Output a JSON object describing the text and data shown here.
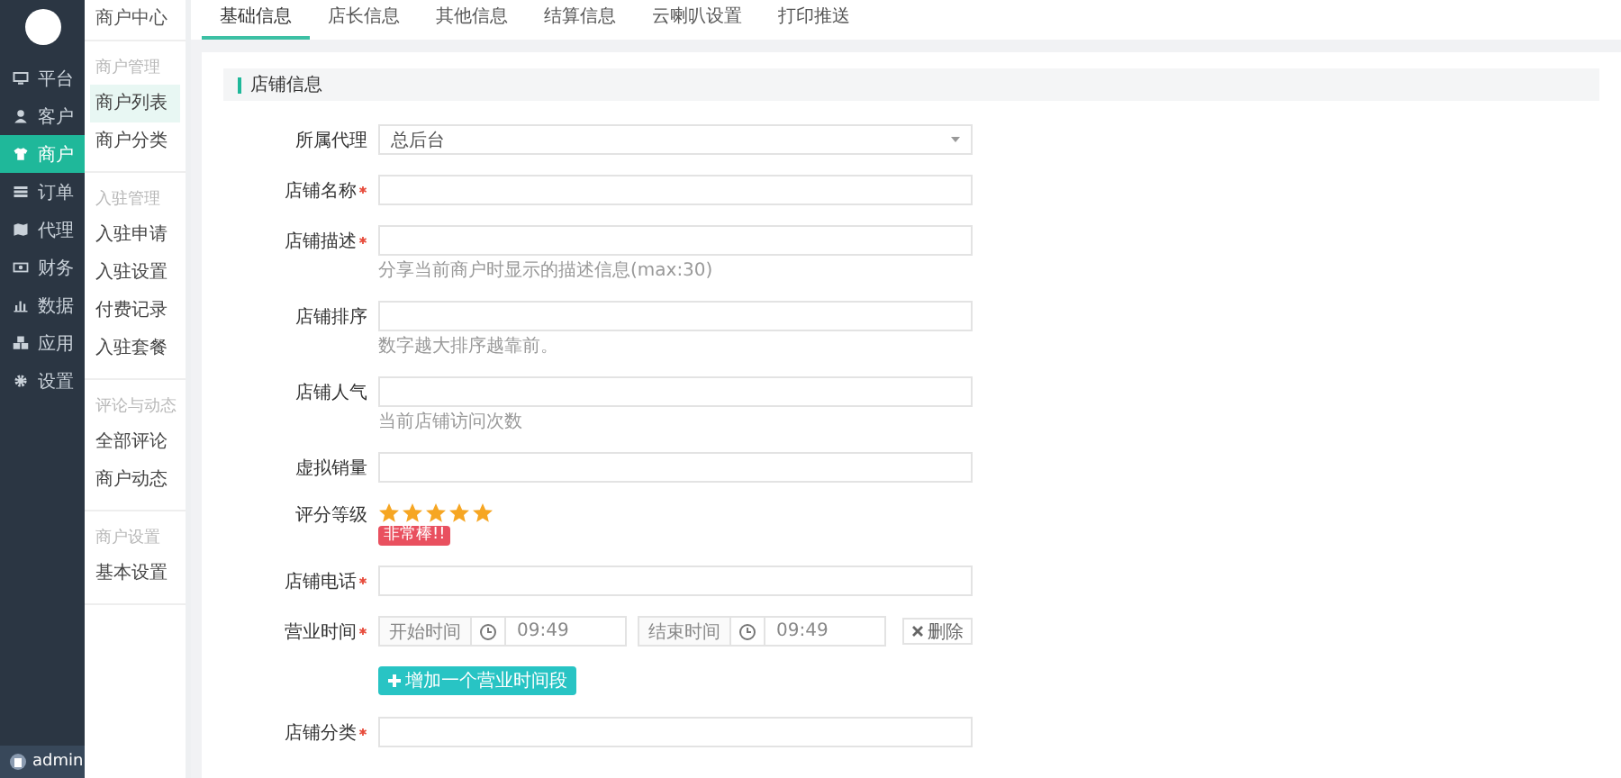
{
  "main_nav": {
    "items": [
      {
        "label": "平台",
        "selected": false
      },
      {
        "label": "客户",
        "selected": false
      },
      {
        "label": "商户",
        "selected": true
      },
      {
        "label": "订单",
        "selected": false
      },
      {
        "label": "代理",
        "selected": false
      },
      {
        "label": "财务",
        "selected": false
      },
      {
        "label": "数据",
        "selected": false
      },
      {
        "label": "应用",
        "selected": false
      },
      {
        "label": "设置",
        "selected": false
      }
    ],
    "user": "admin"
  },
  "sub_nav": {
    "title": "商户中心",
    "groups": [
      {
        "heading": "商户管理",
        "items": [
          {
            "label": "商户列表",
            "selected": true
          },
          {
            "label": "商户分类",
            "selected": false
          }
        ]
      },
      {
        "heading": "入驻管理",
        "items": [
          {
            "label": "入驻申请",
            "selected": false
          },
          {
            "label": "入驻设置",
            "selected": false
          },
          {
            "label": "付费记录",
            "selected": false
          },
          {
            "label": "入驻套餐",
            "selected": false
          }
        ]
      },
      {
        "heading": "评论与动态",
        "items": [
          {
            "label": "全部评论",
            "selected": false
          },
          {
            "label": "商户动态",
            "selected": false
          }
        ]
      },
      {
        "heading": "商户设置",
        "items": [
          {
            "label": "基本设置",
            "selected": false
          }
        ]
      }
    ]
  },
  "tabs": [
    {
      "label": "基础信息",
      "selected": true
    },
    {
      "label": "店长信息",
      "selected": false
    },
    {
      "label": "其他信息",
      "selected": false
    },
    {
      "label": "结算信息",
      "selected": false
    },
    {
      "label": "云喇叭设置",
      "selected": false
    },
    {
      "label": "打印推送",
      "selected": false
    }
  ],
  "section_title": "店铺信息",
  "form": {
    "fields": [
      {
        "kind": "select",
        "label": "所属代理",
        "required": false,
        "value": "总后台"
      },
      {
        "kind": "text",
        "label": "店铺名称",
        "required": true
      },
      {
        "kind": "text",
        "label": "店铺描述",
        "required": true,
        "hint": "分享当前商户时显示的描述信息(max:30)"
      },
      {
        "kind": "text",
        "label": "店铺排序",
        "required": false,
        "hint": "数字越大排序越靠前。"
      },
      {
        "kind": "text",
        "label": "店铺人气",
        "required": false,
        "hint": "当前店铺访问次数"
      },
      {
        "kind": "text",
        "label": "虚拟销量",
        "required": false
      },
      {
        "kind": "rating",
        "label": "评分等级",
        "required": false,
        "stars": 5,
        "badge": "非常棒!!"
      },
      {
        "kind": "text",
        "label": "店铺电话",
        "required": true
      },
      {
        "kind": "time_range",
        "label": "营业时间",
        "required": true,
        "start_label": "开始时间",
        "start_value": "09:49",
        "end_label": "结束时间",
        "end_value": "09:49",
        "delete_label": "删除"
      },
      {
        "kind": "add_button",
        "label": "增加一个营业时间段"
      },
      {
        "kind": "text",
        "label": "店铺分类",
        "required": true
      }
    ]
  }
}
